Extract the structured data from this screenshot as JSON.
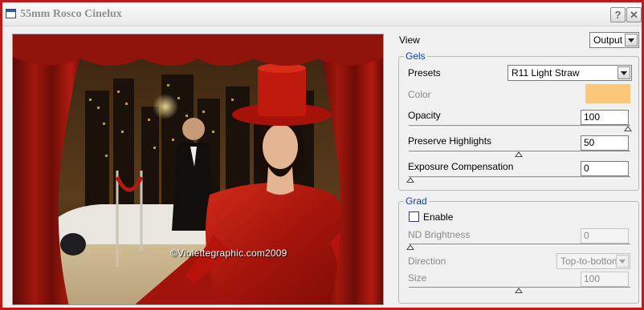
{
  "window": {
    "title": "55mm Rosco Cinelux",
    "help_label": "?",
    "close_label": "✕"
  },
  "preview": {
    "watermark": "©Violettegraphic.com2009"
  },
  "view": {
    "label": "View",
    "value": "Output"
  },
  "gels": {
    "title": "Gels",
    "presets_label": "Presets",
    "presets_value": "R11 Light Straw",
    "color_label": "Color",
    "color_value": "#fdc77a",
    "opacity_label": "Opacity",
    "opacity_value": "100",
    "preserve_label": "Preserve Highlights",
    "preserve_value": "50",
    "exposure_label": "Exposure Compensation",
    "exposure_value": "0"
  },
  "grad": {
    "title": "Grad",
    "enable_label": "Enable",
    "enabled": false,
    "nd_label": "ND Brightness",
    "nd_value": "0",
    "direction_label": "Direction",
    "direction_value": "Top-to-bottom",
    "size_label": "Size",
    "size_value": "100"
  },
  "icons": [
    "window-icon",
    "help-icon",
    "close-icon",
    "chevron-down-icon"
  ]
}
